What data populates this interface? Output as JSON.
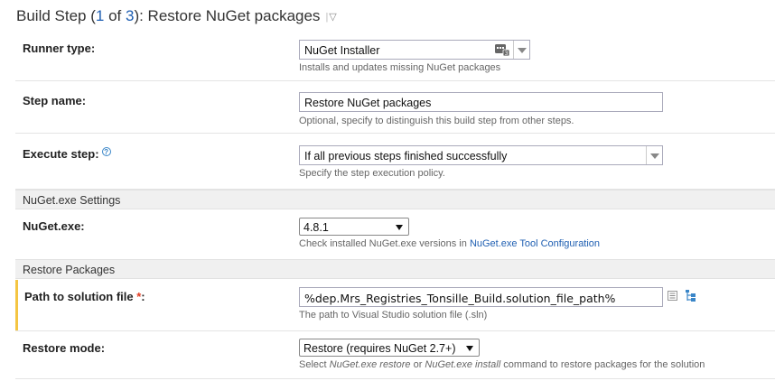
{
  "header": {
    "prefix": "Build Step (",
    "current": "1",
    "of": " of ",
    "total": "3",
    "suffix": "): Restore NuGet packages",
    "caret_bar": "|",
    "caret": "▽"
  },
  "runner_type": {
    "label": "Runner type:",
    "value": "NuGet Installer",
    "hint": "Installs and updates missing NuGet packages"
  },
  "step_name": {
    "label": "Step name:",
    "value": "Restore NuGet packages",
    "hint": "Optional, specify to distinguish this build step from other steps."
  },
  "execute_step": {
    "label": "Execute step:",
    "help": "?",
    "value": "If all previous steps finished successfully",
    "hint": "Specify the step execution policy."
  },
  "section_nuget": {
    "title": "NuGet.exe Settings"
  },
  "nuget_exe": {
    "label": "NuGet.exe:",
    "value": "4.8.1",
    "hint_prefix": "Check installed NuGet.exe versions in ",
    "hint_link": "NuGet.exe Tool Configuration"
  },
  "section_restore": {
    "title": "Restore Packages"
  },
  "solution_path": {
    "label": "Path to solution file ",
    "required": "*",
    "label_suffix": ":",
    "value": "%dep.Mrs_Registries_Tonsille_Build.solution_file_path%",
    "hint": "The path to Visual Studio solution file (.sln)"
  },
  "restore_mode": {
    "label": "Restore mode:",
    "value": "Restore (requires NuGet 2.7+)",
    "hint_1": "Select ",
    "hint_cmd1": "NuGet.exe restore",
    "hint_2": " or ",
    "hint_cmd2": "NuGet.exe install",
    "hint_3": " command to restore packages for the solution"
  },
  "icons": {
    "runner": "runner-badge-icon",
    "text_editor": "text-editor-icon",
    "tree_picker": "tree-picker-icon"
  },
  "colors": {
    "link": "#1f5fb2",
    "required": "#e23a1f",
    "section_bg": "#f0f0f0",
    "accent": "#f4c542"
  }
}
